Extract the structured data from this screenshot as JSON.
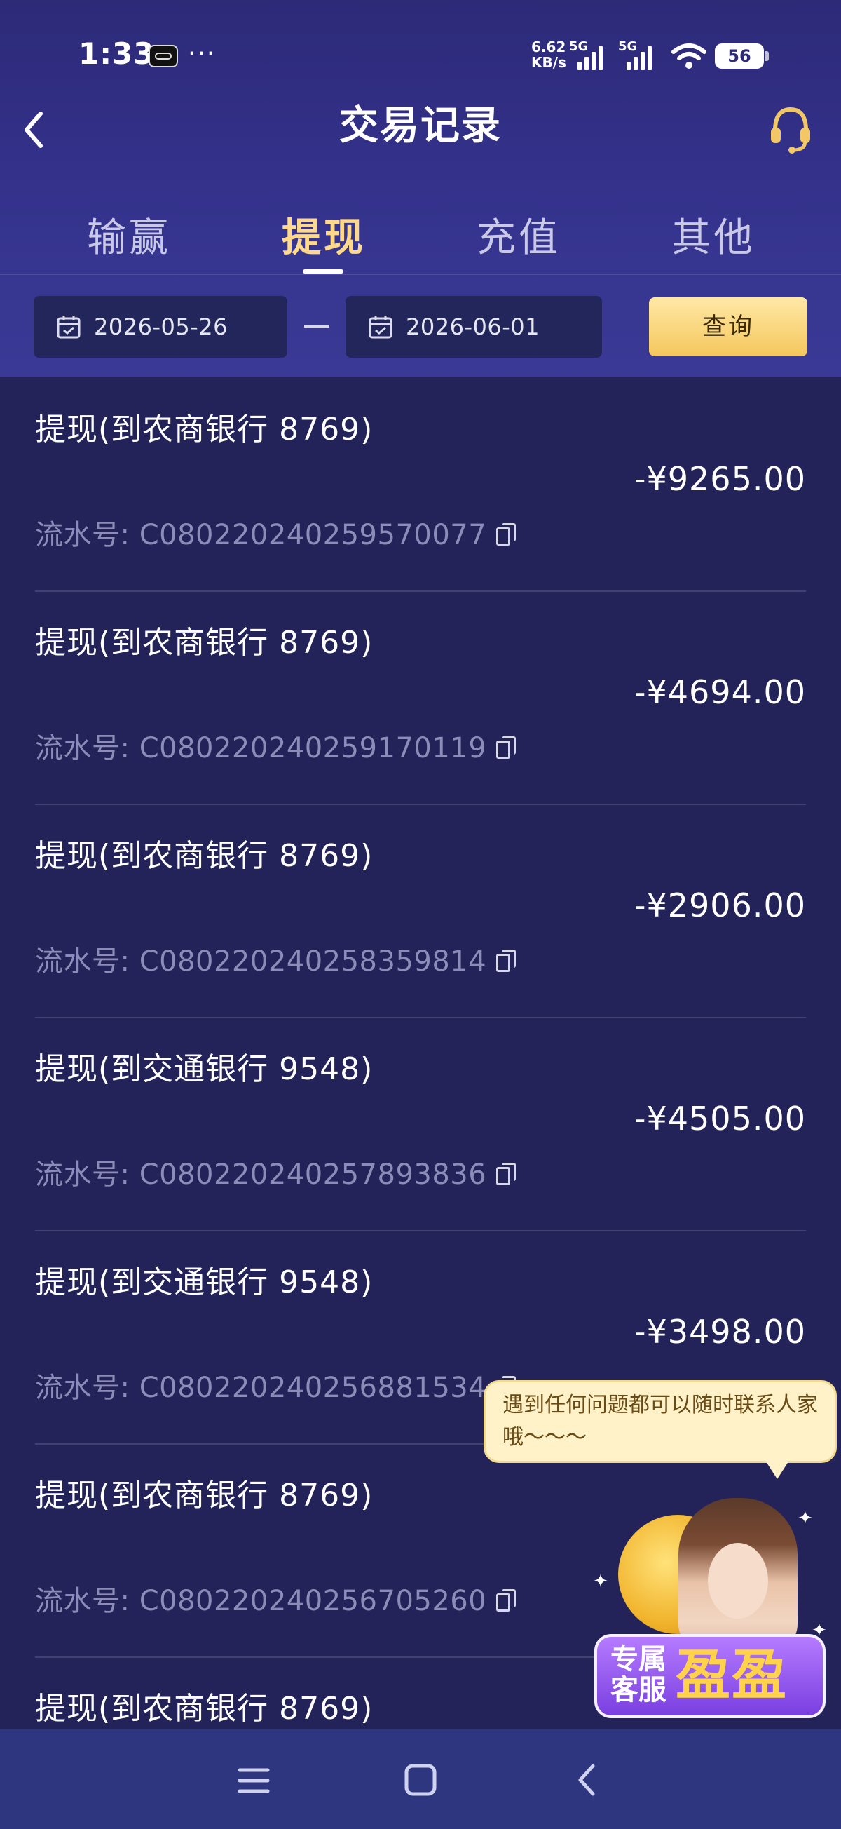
{
  "status_bar": {
    "time": "1:33",
    "dots": "···",
    "net_speed_value": "6.62",
    "net_speed_unit": "KB/s",
    "sim1_label": "5G",
    "sim2_label": "5G",
    "battery": "56"
  },
  "header": {
    "title": "交易记录",
    "back_icon": "chevron-left-icon",
    "service_icon": "headset-icon"
  },
  "tabs": [
    {
      "label": "输赢",
      "active": false
    },
    {
      "label": "提现",
      "active": true
    },
    {
      "label": "充值",
      "active": false
    },
    {
      "label": "其他",
      "active": false
    }
  ],
  "filter": {
    "start_date": "2026-05-26",
    "end_date": "2026-06-01",
    "separator": "—",
    "query_label": "查询"
  },
  "records": [
    {
      "title": "提现(到农商银行 8769)",
      "amount": "-¥9265.00",
      "serial": "流水号: C080220240259570077"
    },
    {
      "title": "提现(到农商银行 8769)",
      "amount": "-¥4694.00",
      "serial": "流水号: C080220240259170119"
    },
    {
      "title": "提现(到农商银行 8769)",
      "amount": "-¥2906.00",
      "serial": "流水号: C080220240258359814"
    },
    {
      "title": "提现(到交通银行 9548)",
      "amount": "-¥4505.00",
      "serial": "流水号: C080220240257893836"
    },
    {
      "title": "提现(到交通银行 9548)",
      "amount": "-¥3498.00",
      "serial": "流水号: C080220240256881534"
    },
    {
      "title": "提现(到农商银行 8769)",
      "amount": "",
      "serial": "流水号: C080220240256705260"
    },
    {
      "title": "提现(到农商银行 8769)",
      "amount": "",
      "serial": ""
    }
  ],
  "service_widget": {
    "tooltip": "遇到任何问题都可以随时联系人家哦～～～",
    "label_small": "专属客服",
    "label_big": "盈盈"
  },
  "colors": {
    "background": "#232259",
    "header": "#33318a",
    "active_tab": "#ffd98b",
    "query_button": "#f5c75c",
    "serial_text": "#8d8cb8",
    "bottom_nav": "#2f3680"
  }
}
